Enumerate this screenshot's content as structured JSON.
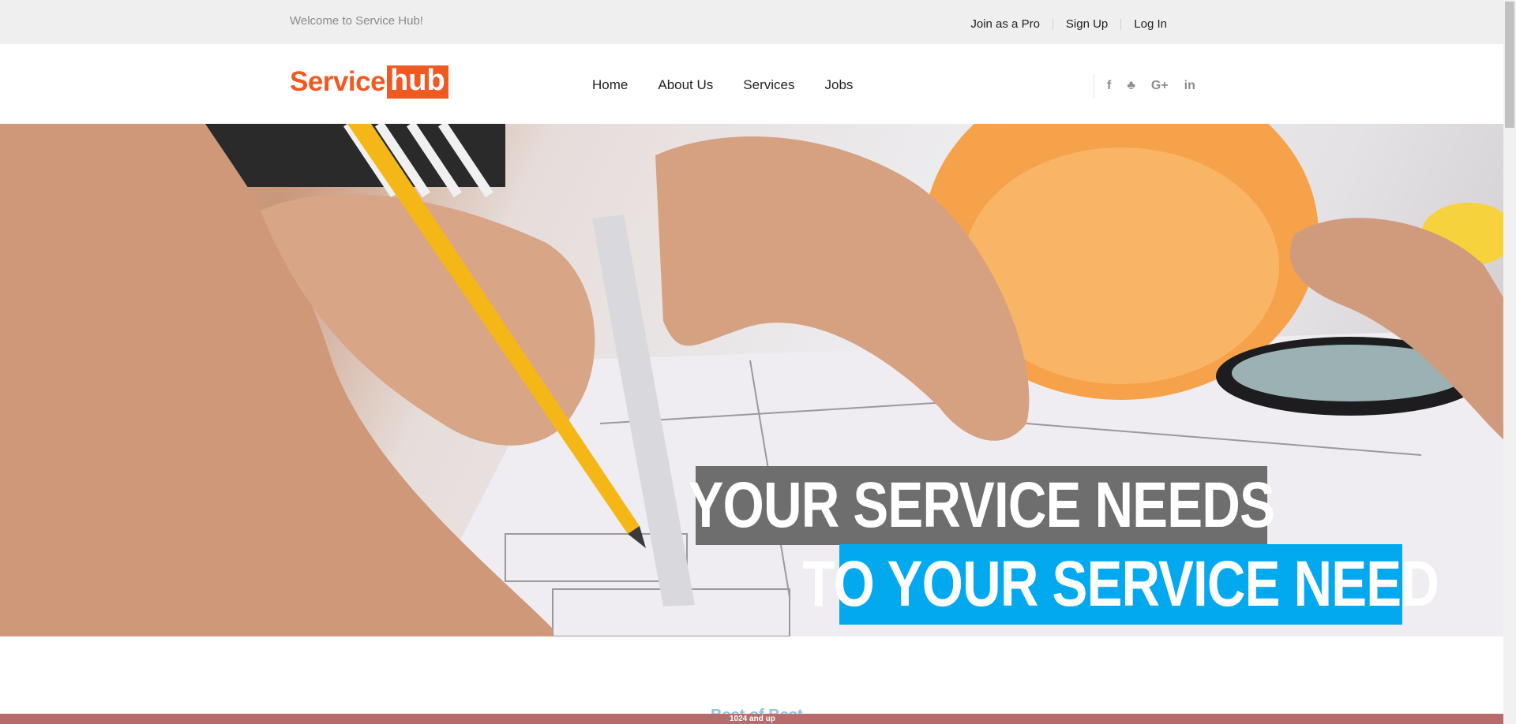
{
  "topbar": {
    "welcome": "Welcome to Service Hub!",
    "links": [
      "Join as a Pro",
      "Sign Up",
      "Log In"
    ]
  },
  "header": {
    "logo_part1": "Service",
    "logo_part2": "hub",
    "nav": [
      "Home",
      "About Us",
      "Services",
      "Jobs"
    ],
    "social_icons": [
      "facebook-icon",
      "twitter-icon",
      "google-plus-icon",
      "linkedin-icon"
    ],
    "social_glyphs": [
      "f",
      "♣",
      "G+",
      "in"
    ]
  },
  "hero": {
    "headline_line1": "YOUR SERVICE NEEDS",
    "headline_line2": "TO YOUR SERVICE NEED",
    "colors": {
      "band1": "#6e6e6e",
      "band2": "#03a9ef"
    }
  },
  "below": {
    "section_heading": "Best of Best",
    "breakpoint_label": "1024 and up"
  },
  "colors": {
    "brand": "#ef5a22",
    "topbar": "#efefef"
  }
}
